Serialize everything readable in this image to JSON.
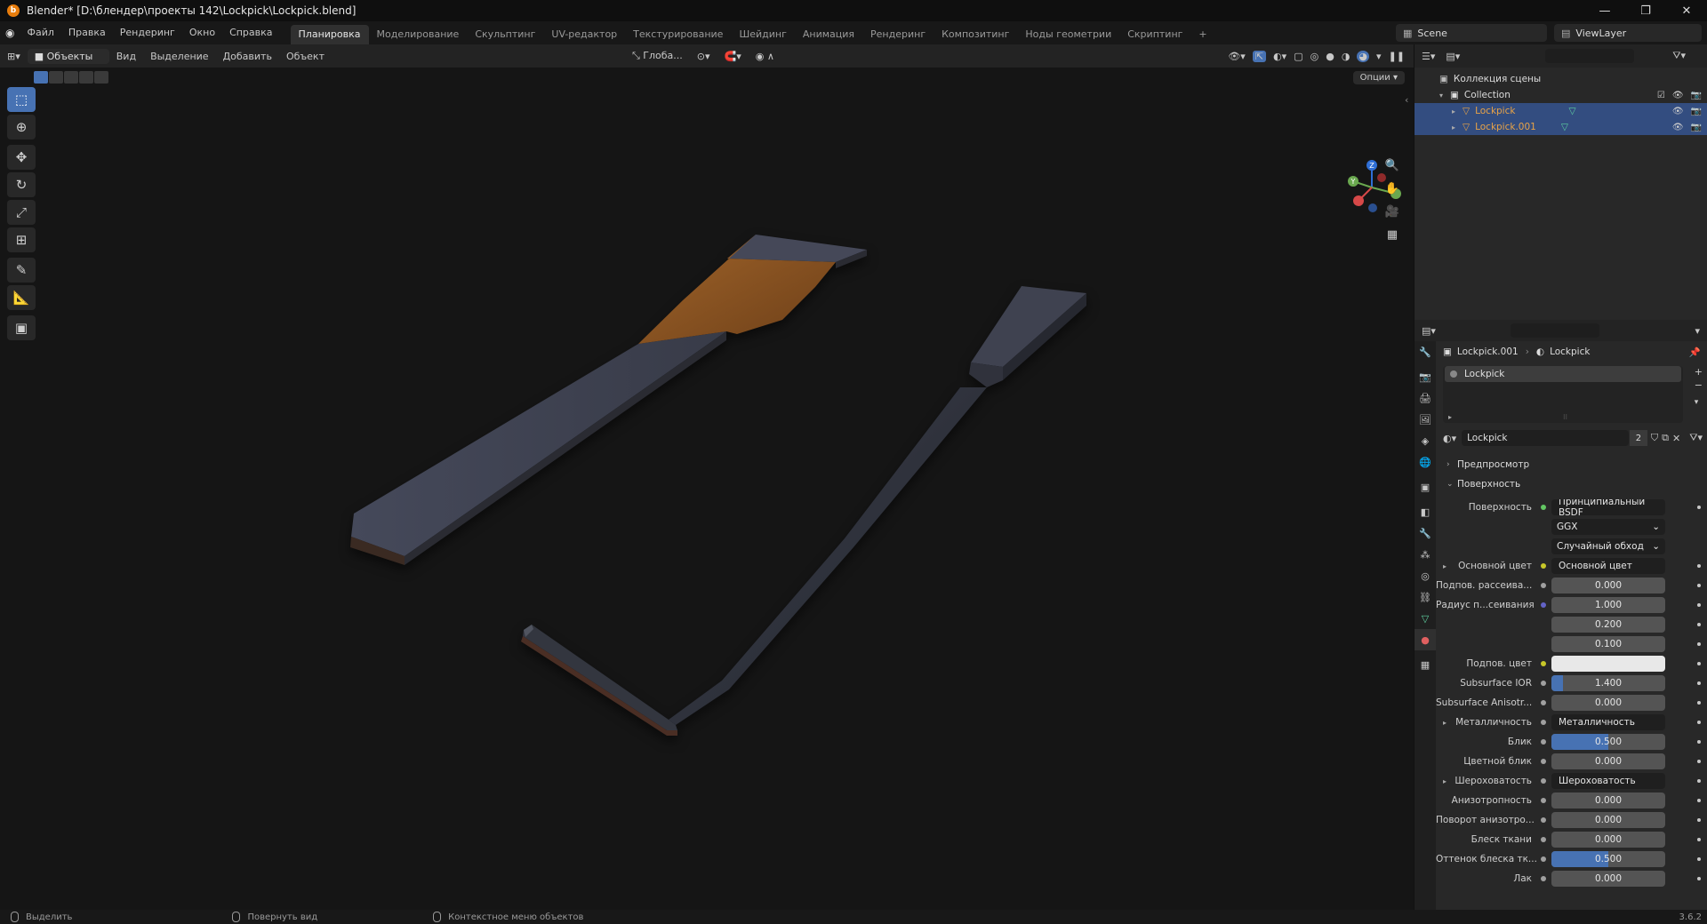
{
  "window": {
    "title": "Blender* [D:\\блендер\\проекты 142\\Lockpick\\Lockpick.blend]",
    "controls": [
      "—",
      "❐",
      "✕"
    ]
  },
  "topbar": {
    "menus": [
      "Файл",
      "Правка",
      "Рендеринг",
      "Окно",
      "Справка"
    ],
    "workspaces": [
      "Планировка",
      "Моделирование",
      "Скульптинг",
      "UV-редактор",
      "Текстурирование",
      "Шейдинг",
      "Анимация",
      "Рендеринг",
      "Композитинг",
      "Ноды геометрии",
      "Скриптинг"
    ],
    "active_workspace": "Планировка",
    "add_tab": "+",
    "scene": "Scene",
    "view_layer": "ViewLayer"
  },
  "viewport_header": {
    "mode": "Объекты",
    "menus": [
      "Вид",
      "Выделение",
      "Добавить",
      "Объект"
    ],
    "transform_orientation": "Глоба...",
    "options": "Опции"
  },
  "tools": [
    "select-box",
    "cursor",
    "move",
    "rotate",
    "scale",
    "transform",
    "annotate",
    "measure",
    "add-cube"
  ],
  "gizmo": {
    "x": "X",
    "y": "Y",
    "z": "Z"
  },
  "outliner": {
    "rows": [
      {
        "label": "Коллекция сцены",
        "depth": 0,
        "selected": false
      },
      {
        "label": "Collection",
        "depth": 1,
        "selected": false
      },
      {
        "label": "Lockpick",
        "depth": 2,
        "selected": true,
        "color": "#e8a347"
      },
      {
        "label": "Lockpick.001",
        "depth": 2,
        "selected": true,
        "color": "#e8a347"
      }
    ]
  },
  "properties": {
    "breadcrumb": {
      "object": "Lockpick.001",
      "material": "Lockpick"
    },
    "slots": [
      "Lockpick"
    ],
    "material_name": "Lockpick",
    "user_count": "2",
    "panels": {
      "preview": "Предпросмотр",
      "surface": "Поверхность"
    },
    "rows": [
      {
        "label": "Поверхность",
        "type": "node",
        "value": "Принципиальный BSDF",
        "dot": "green"
      },
      {
        "label": "",
        "type": "select",
        "value": "GGX"
      },
      {
        "label": "",
        "type": "select",
        "value": "Случайный обход"
      },
      {
        "label": "Основной цвет",
        "type": "node",
        "value": "Основной цвет",
        "dot": "yellow",
        "expand": true
      },
      {
        "label": "Подпов. рассеива...",
        "type": "num",
        "value": "0.000",
        "fill": 0
      },
      {
        "label": "Радиус п...сеивания",
        "type": "num",
        "value": "1.000",
        "fill": 0,
        "dot": "violet"
      },
      {
        "label": "",
        "type": "num",
        "value": "0.200",
        "fill": 0,
        "nodot": true
      },
      {
        "label": "",
        "type": "num",
        "value": "0.100",
        "fill": 0,
        "nodot": true
      },
      {
        "label": "Подпов. цвет",
        "type": "color",
        "value": "",
        "dot": "yellow"
      },
      {
        "label": "Subsurface IOR",
        "type": "num",
        "value": "1.400",
        "fill": 0.1
      },
      {
        "label": "Subsurface Anisotr...",
        "type": "num",
        "value": "0.000",
        "fill": 0
      },
      {
        "label": "Металличность",
        "type": "node",
        "value": "Металличность",
        "expand": true
      },
      {
        "label": "Блик",
        "type": "num",
        "value": "0.500",
        "fill": 0.5
      },
      {
        "label": "Цветной блик",
        "type": "num",
        "value": "0.000",
        "fill": 0
      },
      {
        "label": "Шероховатость",
        "type": "node",
        "value": "Шероховатость",
        "expand": true
      },
      {
        "label": "Анизотропность",
        "type": "num",
        "value": "0.000",
        "fill": 0
      },
      {
        "label": "Поворот анизотро...",
        "type": "num",
        "value": "0.000",
        "fill": 0
      },
      {
        "label": "Блеск ткани",
        "type": "num",
        "value": "0.000",
        "fill": 0
      },
      {
        "label": "Оттенок блеска тк...",
        "type": "num",
        "value": "0.500",
        "fill": 0.5
      },
      {
        "label": "Лак",
        "type": "num",
        "value": "0.000",
        "fill": 0
      }
    ]
  },
  "statusbar": {
    "items": [
      "Выделить",
      "Повернуть вид",
      "Контекстное меню объектов"
    ],
    "version": "3.6.2"
  },
  "colors": {
    "accent": "#4772b3",
    "selected_row": "#334d80",
    "object_orange": "#e8a347"
  }
}
